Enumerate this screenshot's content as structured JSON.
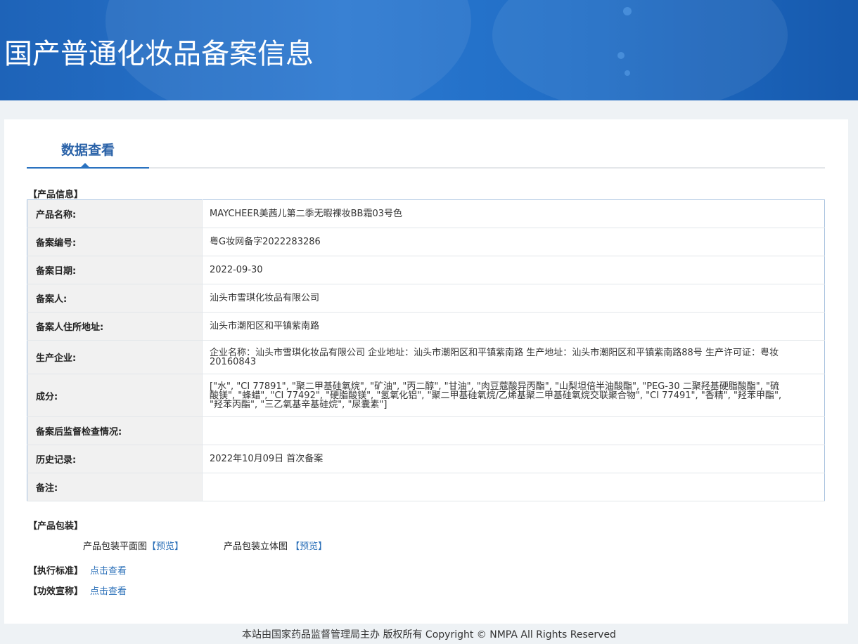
{
  "banner": {
    "title": "国产普通化妆品备案信息"
  },
  "tab": {
    "label": "数据查看"
  },
  "product_info": {
    "section_title": "【产品信息】",
    "rows": [
      {
        "label": "产品名称:",
        "value": "MAYCHEER美茜儿第二季无暇裸妆BB霜03号色"
      },
      {
        "label": "备案编号:",
        "value": "粤G妆网备字2022283286"
      },
      {
        "label": "备案日期:",
        "value": "2022-09-30"
      },
      {
        "label": "备案人:",
        "value": "汕头市雪琪化妆品有限公司"
      },
      {
        "label": "备案人住所地址:",
        "value": "汕头市潮阳区和平镇紫南路"
      },
      {
        "label": "生产企业:",
        "value": "企业名称：汕头市雪琪化妆品有限公司 企业地址：汕头市潮阳区和平镇紫南路 生产地址：汕头市潮阳区和平镇紫南路88号 生产许可证：粤妆20160843"
      },
      {
        "label": "成分:",
        "value": "[\"水\", \"CI 77891\", \"聚二甲基硅氧烷\", \"矿油\", \"丙二醇\", \"甘油\", \"肉豆蔻酸异丙酯\", \"山梨坦倍半油酸酯\", \"PEG-30 二聚羟基硬脂酸酯\", \"硫酸镁\", \"蜂蜡\", \"CI 77492\", \"硬脂酸镁\", \"氢氧化铝\", \"聚二甲基硅氧烷/乙烯基聚二甲基硅氧烷交联聚合物\", \"CI 77491\", \"香精\", \"羟苯甲酯\", \"羟苯丙酯\", \"三乙氧基辛基硅烷\", \"尿囊素\"]"
      },
      {
        "label": "备案后监督检查情况:",
        "value": ""
      },
      {
        "label": "历史记录:",
        "value": "2022年10月09日 首次备案"
      },
      {
        "label": "备注:",
        "value": ""
      }
    ]
  },
  "packaging": {
    "section_title": "【产品包装】",
    "flat_label": "产品包装平面图",
    "flat_link": "【预览】",
    "solid_label": "产品包装立体图",
    "solid_link": "【预览】"
  },
  "standard": {
    "label": "【执行标准】",
    "link": "点击查看"
  },
  "efficacy": {
    "label": "【功效宣称】",
    "link": "点击查看"
  },
  "footer": {
    "text": "本站由国家药品监督管理局主办 版权所有 Copyright © NMPA All Rights Reserved"
  }
}
